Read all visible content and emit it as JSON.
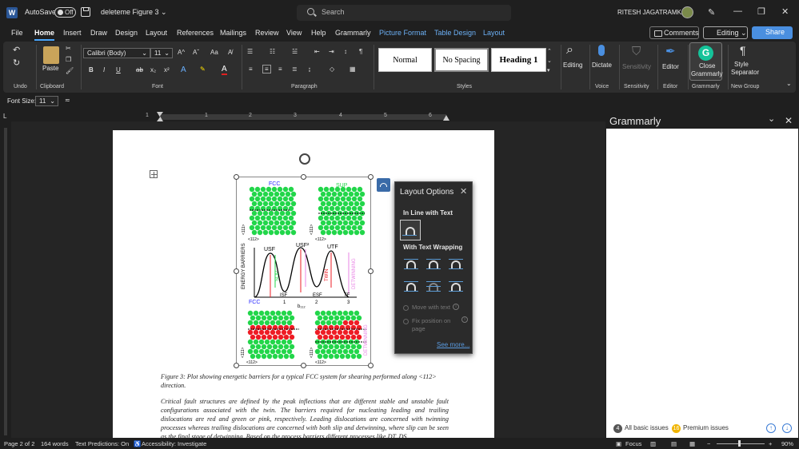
{
  "titlebar": {
    "autosave_label": "AutoSave",
    "autosave_state": "Off",
    "doc_title": "deleteme Figure 3 ⌄",
    "search_placeholder": "Search",
    "user_name": "RITESH JAGATRAMKA"
  },
  "menu_tabs": [
    "File",
    "Home",
    "Insert",
    "Draw",
    "Design",
    "Layout",
    "References",
    "Mailings",
    "Review",
    "View",
    "Help",
    "Grammarly",
    "Picture Format",
    "Table Design",
    "Layout"
  ],
  "active_tab": "Home",
  "context_tabs": [
    "Picture Format",
    "Table Design",
    "Layout"
  ],
  "top_right": {
    "comments": "Comments",
    "editing": "Editing",
    "share": "Share"
  },
  "ribbon": {
    "undo_group": "Undo",
    "clipboard_group": "Clipboard",
    "paste_label": "Paste",
    "font_group": "Font",
    "font_name": "Calibri (Body)",
    "font_size": "11",
    "paragraph_group": "Paragraph",
    "styles_group": "Styles",
    "styles": [
      "Normal",
      "No Spacing",
      "Heading 1"
    ],
    "editing_label": "Editing",
    "dictate_label": "Dictate",
    "voice_group": "Voice",
    "sensitivity_label": "Sensitivity",
    "sensitivity_group": "Sensitivity",
    "editor_label": "Editor",
    "editor_group": "Editor",
    "close_grammarly_line1": "Close",
    "close_grammarly_line2": "Grammarly",
    "grammarly_group": "Grammarly",
    "style_sep_line1": "Style",
    "style_sep_line2": "Separator",
    "new_group": "New Group"
  },
  "fontsize_bar": {
    "label": "Font Size:",
    "value": "11"
  },
  "ruler_numbers": [
    "1",
    "1",
    "2",
    "3",
    "4",
    "5",
    "6"
  ],
  "figure": {
    "labels": {
      "fcc_top": "FCC",
      "sup": "SUP",
      "axis_112": "<112>",
      "axis_111": "<111>",
      "usf": "USF",
      "usf2": "USF²",
      "utf": "UTF",
      "energy_barriers": "ENERGY BARRIERS",
      "isf": "ISF",
      "esf": "ESF",
      "tf": "TF",
      "fcc_bottom": "FCC",
      "x1": "1",
      "x2": "2",
      "x3": "3",
      "bvec": "b₁₁₂",
      "slip": "SLIP",
      "twin": "TWIN",
      "detwinning": "DETWINNING"
    }
  },
  "caption": "Figure 3: Plot showing energetic barriers for a typical FCC system for shearing performed along <112> direction.",
  "body_text": "Critical fault structures are defined by the peak inflections that are different stable and unstable fault configurations associated with the twin. The barriers required for nucleating leading and trailing dislocations are red and green or pink, respectively. Leading dislocations are concerned with twinning processes whereas trailing dislocations are concerned with both slip and detwinning, where slip can be seen as the final stage of detwinning. Based on the process barriers different processes like DT, DS",
  "layout_options": {
    "title": "Layout Options",
    "inline_heading": "In Line with Text",
    "wrap_heading": "With Text Wrapping",
    "move_with_text": "Move with text",
    "fix_position_line1": "Fix position on",
    "fix_position_line2": "page",
    "see_more": "See more..."
  },
  "grammarly": {
    "title": "Grammarly",
    "basic_count": "4",
    "basic_label": "All basic issues",
    "premium_count": "16",
    "premium_label": "Premium issues"
  },
  "status": {
    "page": "Page 2 of 2",
    "words": "164 words",
    "predictions": "Text Predictions: On",
    "accessibility": "Accessibility: Investigate",
    "focus": "Focus",
    "zoom": "90%"
  },
  "colors": {
    "accent": "#4a8fe0",
    "grammarly": "#15c39a",
    "slip_green": "#22d64a",
    "twin_red": "#ee1c24",
    "detwin_pink": "#e986e6"
  }
}
